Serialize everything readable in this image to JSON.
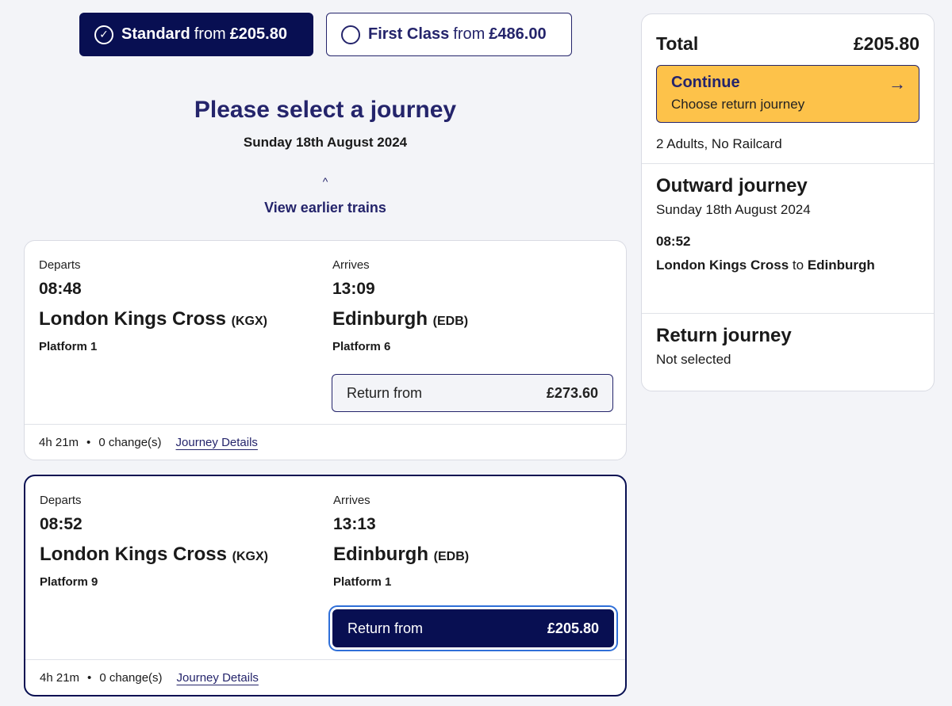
{
  "fare_toggle": {
    "standard": {
      "name": "Standard",
      "from": "from",
      "price": "£205.80",
      "check": "✓"
    },
    "first": {
      "name": "First Class",
      "from": "from",
      "price": "£486.00"
    }
  },
  "heading": {
    "title": "Please select a journey",
    "date": "Sunday 18th August 2024",
    "earlier_chevron": "^",
    "earlier_label": "View earlier trains"
  },
  "journeys": [
    {
      "departs_label": "Departs",
      "depart_time": "08:48",
      "depart_station": "London Kings Cross",
      "depart_code": "(KGX)",
      "depart_platform": "Platform 1",
      "arrives_label": "Arrives",
      "arrive_time": "13:09",
      "arrive_station": "Edinburgh",
      "arrive_code": "(EDB)",
      "arrive_platform": "Platform 6",
      "price_label": "Return from",
      "price": "£273.60",
      "duration": "4h 21m",
      "changes": "0 change(s)",
      "details_link": "Journey Details"
    },
    {
      "departs_label": "Departs",
      "depart_time": "08:52",
      "depart_station": "London Kings Cross",
      "depart_code": "(KGX)",
      "depart_platform": "Platform 9",
      "arrives_label": "Arrives",
      "arrive_time": "13:13",
      "arrive_station": "Edinburgh",
      "arrive_code": "(EDB)",
      "arrive_platform": "Platform 1",
      "price_label": "Return from",
      "price": "£205.80",
      "duration": "4h 21m",
      "changes": "0 change(s)",
      "details_link": "Journey Details"
    }
  ],
  "summary": {
    "total_label": "Total",
    "total_value": "£205.80",
    "continue_title": "Continue",
    "continue_sub": "Choose return journey",
    "arrow": "→",
    "passengers": "2 Adults, No Railcard",
    "outward": {
      "title": "Outward journey",
      "date": "Sunday 18th August 2024",
      "time": "08:52",
      "from": "London Kings Cross",
      "to_word": "to",
      "to": "Edinburgh"
    },
    "return": {
      "title": "Return journey",
      "status": "Not selected"
    }
  },
  "colors": {
    "navy": "#080f52",
    "brand_text": "#24246b",
    "continue_yellow": "#fdc24a",
    "focus_blue": "#2f6fd8",
    "background": "#f3f4f8"
  }
}
